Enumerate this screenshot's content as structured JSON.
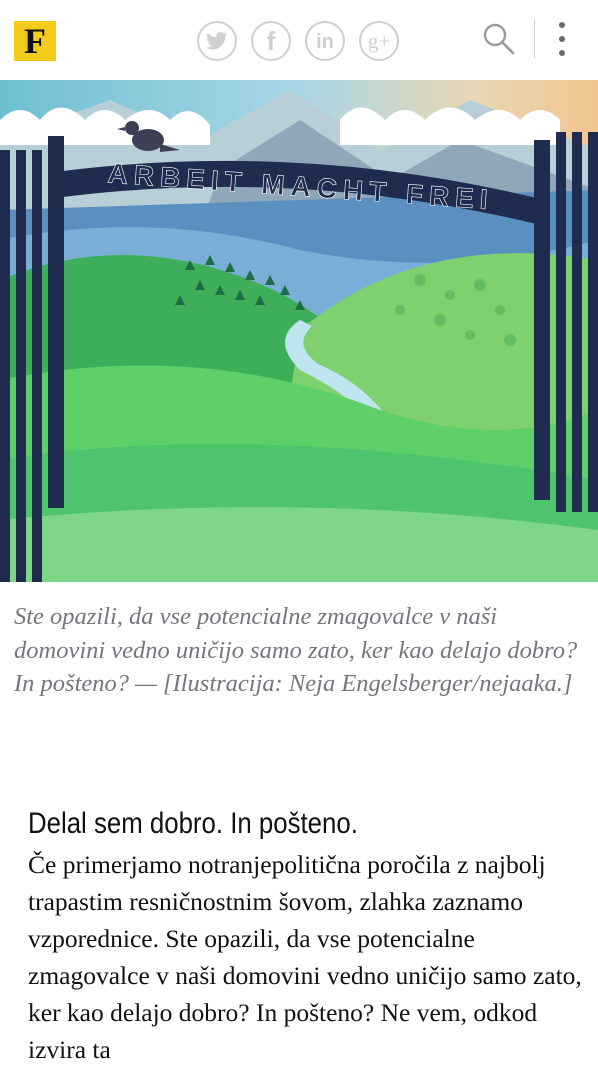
{
  "header": {
    "logo_letter": "F",
    "brand_color": "#f3cb1a",
    "icon_color": "#cfcfcf",
    "social_icons": [
      "twitter-icon",
      "facebook-icon",
      "linkedin-icon",
      "google-plus-icon"
    ],
    "facebook_glyph": "f",
    "linkedin_glyph": "in",
    "googleplus_glyph": "g+",
    "search_icon": "search-icon",
    "menu_icon": "more-vertical-icon"
  },
  "hero": {
    "gate_sign": "ARBEIT MACHT FREI",
    "colors": {
      "sky": "#9ec5d8",
      "mountain": "#b9cfd8",
      "field": "#6fcf6a",
      "bars": "#1f2c4f"
    }
  },
  "caption": "Ste opazili, da vse potencialne zmagovalce v naši domovini vedno uničijo samo zato, ker kao delajo dobro? In pošteno? — [Ilustracija: Neja Engelsberger/nejaaka.]",
  "article": {
    "heading": "Delal sem dobro. In pošteno.",
    "paragraph": "Če primerjamo notranjepolitična poročila z najbolj trapastim resničnostnim šovom, zlahka zaznamo vzporednice. Ste opazili, da vse potencialne zmagovalce v naši domovini vedno uničijo samo zato, ker kao delajo dobro? In pošteno? Ne vem, odkod izvira ta"
  }
}
